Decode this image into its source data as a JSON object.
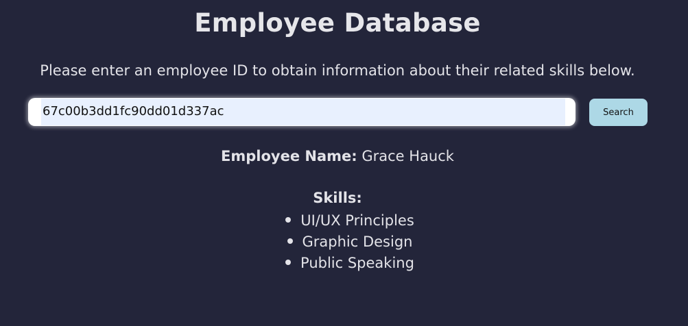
{
  "header": {
    "title": "Employee Database",
    "instructions": "Please enter an employee ID to obtain information about their related skills below."
  },
  "search": {
    "value": "67c00b3dd1fc90dd01d337ac",
    "button_label": "Search"
  },
  "employee": {
    "name_label": "Employee Name:",
    "name": "Grace Hauck",
    "skills_label": "Skills:",
    "skills": [
      "UI/UX Principles",
      "Graphic Design",
      "Public Speaking"
    ]
  },
  "colors": {
    "background": "#23253a",
    "text": "#e3e3e8",
    "button": "#add8e6",
    "input_autofill": "#e8f0fe"
  }
}
